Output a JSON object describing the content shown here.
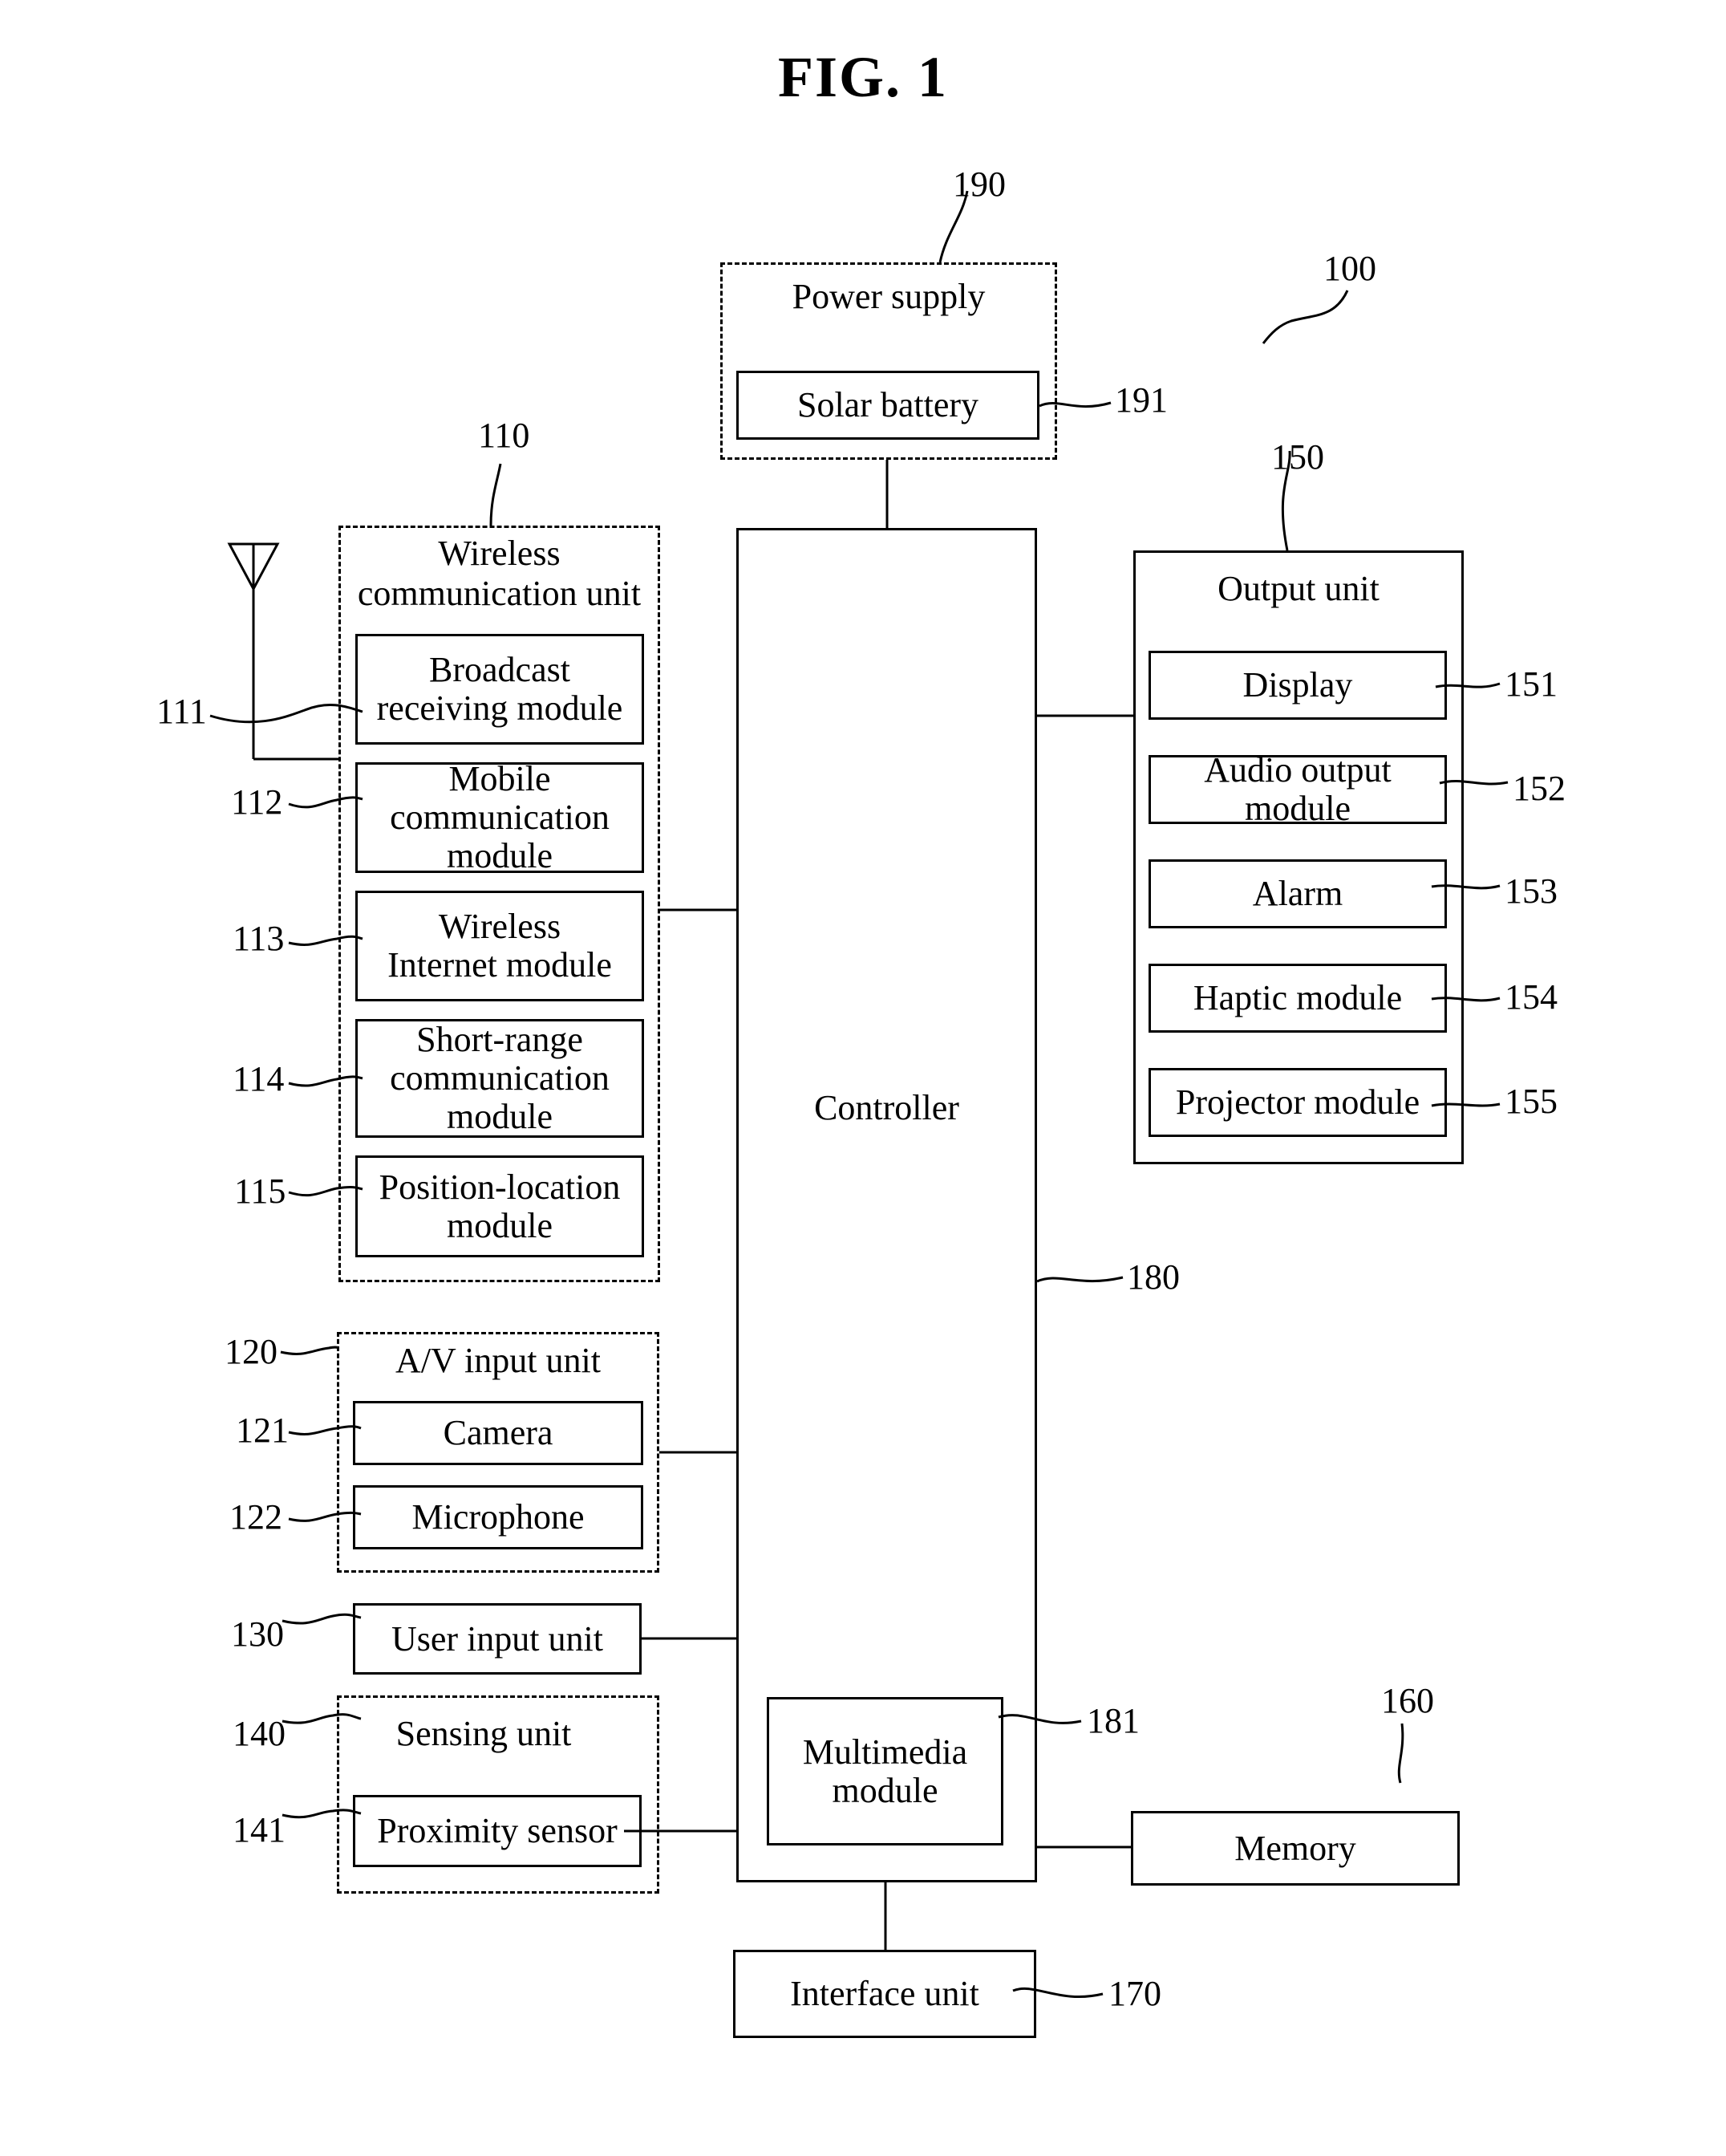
{
  "figure": {
    "title": "FIG. 1",
    "device_ref": "100"
  },
  "power_supply": {
    "ref": "190",
    "label": "Power supply",
    "solar_battery": {
      "ref": "191",
      "label": "Solar battery"
    }
  },
  "wireless_unit": {
    "ref": "110",
    "label": "Wireless\ncommunication unit",
    "modules": [
      {
        "ref": "111",
        "label": "Broadcast\nreceiving module"
      },
      {
        "ref": "112",
        "label": "Mobile\ncommunication\nmodule"
      },
      {
        "ref": "113",
        "label": "Wireless\nInternet module"
      },
      {
        "ref": "114",
        "label": "Short-range\ncommunication\nmodule"
      },
      {
        "ref": "115",
        "label": "Position-location\nmodule"
      }
    ]
  },
  "av_input_unit": {
    "ref": "120",
    "label": "A/V input unit",
    "modules": [
      {
        "ref": "121",
        "label": "Camera"
      },
      {
        "ref": "122",
        "label": "Microphone"
      }
    ]
  },
  "user_input_unit": {
    "ref": "130",
    "label": "User input unit"
  },
  "sensing_unit": {
    "ref": "140",
    "label": "Sensing unit",
    "modules": [
      {
        "ref": "141",
        "label": "Proximity sensor"
      }
    ]
  },
  "output_unit": {
    "ref": "150",
    "label": "Output unit",
    "modules": [
      {
        "ref": "151",
        "label": "Display"
      },
      {
        "ref": "152",
        "label": "Audio output module"
      },
      {
        "ref": "153",
        "label": "Alarm"
      },
      {
        "ref": "154",
        "label": "Haptic module"
      },
      {
        "ref": "155",
        "label": "Projector module"
      }
    ]
  },
  "memory": {
    "ref": "160",
    "label": "Memory"
  },
  "interface_unit": {
    "ref": "170",
    "label": "Interface unit"
  },
  "controller": {
    "ref": "180",
    "label": "Controller",
    "multimedia": {
      "ref": "181",
      "label": "Multimedia\nmodule"
    }
  }
}
